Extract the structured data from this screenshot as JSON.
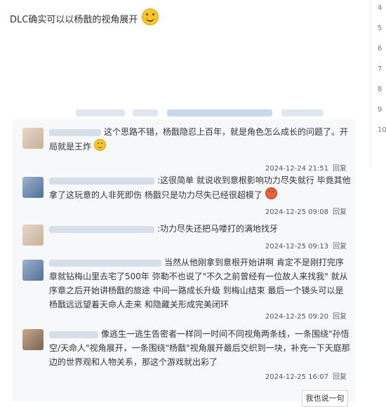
{
  "main_post": {
    "text": "DLC确实可以以杨戬的视角展开"
  },
  "right_numbers": [
    "4",
    "5",
    "6",
    "7",
    "8",
    "9",
    "10"
  ],
  "comments": [
    {
      "text": "这个思路不错，杨戬隐忍上百年，就是角色怎么成长的问题了。开局就是王炸",
      "time": "2024-12-24 21:51",
      "reply": "回复"
    },
    {
      "text": ":这很简单 就说收到意根影响功力尽失就行 毕竟其他拿了这玩意的人非死即伤 杨戬只是功力尽失已经很超模了",
      "time": "2024-12-25 09:08",
      "reply": "回复"
    },
    {
      "text": ":功力尽失还把马喽打的满地找牙",
      "time": "2024-12-25 09:13",
      "reply": "回复"
    },
    {
      "text": "当然从他刚拿到意根开始讲啊 肯定不是刚打完序章就钻梅山里去宅了500年 弥勒不也说了\"不久之前曾经有一位故人来找我\" 就从序章之后开始讲杨戬的旅途 中间一路成长升级 到梅山结束 最后一个镜头可以是杨戬远远望着天命人走来 和隐藏关形成完美闭环",
      "time": "2024-12-25 09:20",
      "reply": "回复"
    },
    {
      "text": "像逃生一逃生告密者一样同一时间不同视角两条线，一条围绕\"孙悟空/天命人\"视角展开，一条围绕\"杨戬\"视角展开最后交织到一块，补充一下天庭那边的世界观和人物关系，那这个游戏就出彩了",
      "time": "2024-12-25 16:07",
      "reply": "回复"
    }
  ],
  "say_button": "我也说一句",
  "colors": {
    "panel_bg": "#f7f8fa",
    "emoji": "#f6c52a"
  }
}
